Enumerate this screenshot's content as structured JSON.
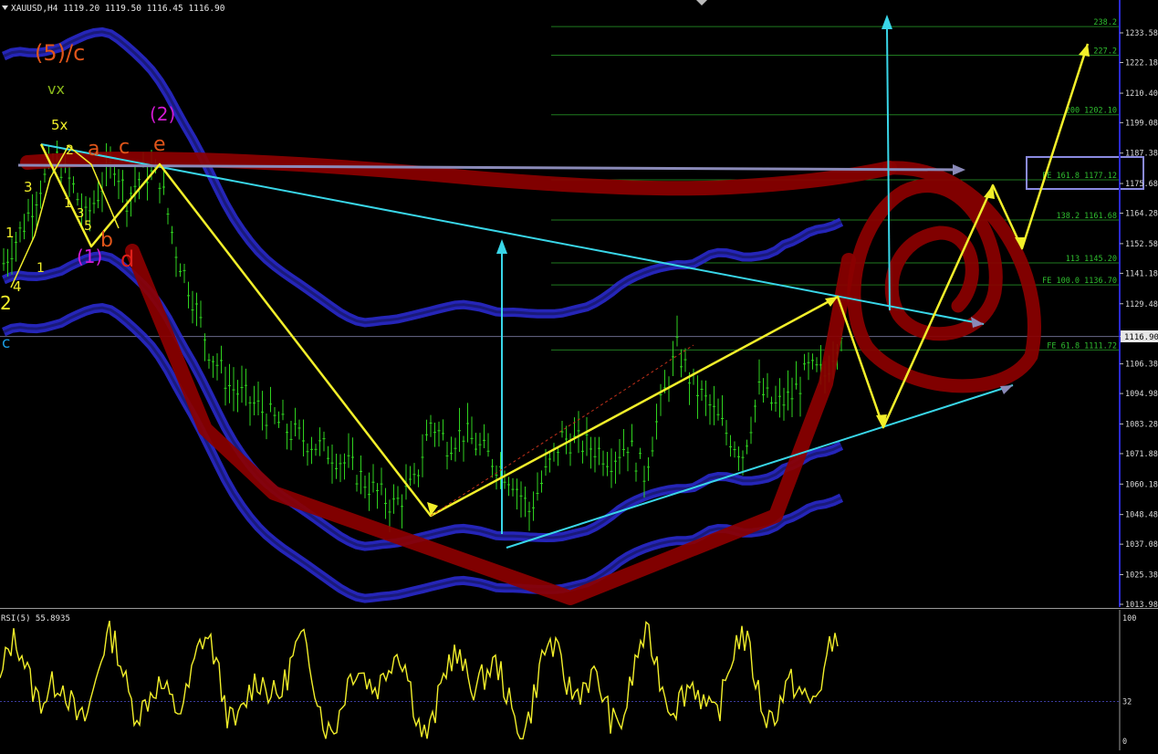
{
  "header": {
    "symbol_line": "XAUUSD,H4  1119.20 1119.50 1116.45 1116.90"
  },
  "colors": {
    "background": "#000000",
    "candles": "#2fd11f",
    "envelope": "#2b2bd8",
    "envelope_core": "#1a1a7a",
    "trend_cyan": "#39d6e8",
    "wave_yellow": "#f2ef2a",
    "hand_red": "#8b0000",
    "fib_line": "#1f7a1f",
    "fib_text": "#2fbf2f",
    "axis": "#2a2ad0",
    "grey_arrow": "#8a8ab8",
    "rsi": "#f2ef2a"
  },
  "chart_data": [
    {
      "type": "candlestick",
      "title": "XAUUSD,H4",
      "ohlc_label": "1119.20 1119.50 1116.45 1116.90",
      "current_price": 1116.9,
      "ylim": [
        1013.98,
        1240.0
      ],
      "y_ticks": [
        1233.58,
        1222.18,
        1210.4,
        1199.08,
        1187.38,
        1175.68,
        1164.28,
        1152.58,
        1141.18,
        1129.48,
        1116.9,
        1106.38,
        1094.98,
        1083.28,
        1071.88,
        1060.18,
        1048.48,
        1037.08,
        1025.38,
        1013.98
      ],
      "y_tick_labels": [
        "1233.58",
        "1222.18",
        "1210.40",
        "1199.08",
        "1187.38",
        "1175.68",
        "1164.28",
        "1152.58",
        "1141.18",
        "1129.48",
        "1116.90",
        "1106.38",
        "1094.98",
        "1083.28",
        "1071.88",
        "1060.18",
        "1048.48",
        "1037.08",
        "1025.38",
        "1013.98"
      ],
      "price_path": [
        [
          0,
          1145
        ],
        [
          5,
          1160
        ],
        [
          9,
          1175
        ],
        [
          13,
          1185
        ],
        [
          17,
          1174
        ],
        [
          20,
          1162
        ],
        [
          24,
          1175
        ],
        [
          27,
          1184
        ],
        [
          30,
          1170
        ],
        [
          34,
          1180
        ],
        [
          38,
          1178
        ],
        [
          42,
          1150
        ],
        [
          46,
          1132
        ],
        [
          50,
          1112
        ],
        [
          55,
          1098
        ],
        [
          60,
          1092
        ],
        [
          65,
          1086
        ],
        [
          70,
          1080
        ],
        [
          75,
          1076
        ],
        [
          80,
          1072
        ],
        [
          85,
          1066
        ],
        [
          90,
          1058
        ],
        [
          95,
          1052
        ],
        [
          100,
          1060
        ],
        [
          104,
          1084
        ],
        [
          108,
          1076
        ],
        [
          112,
          1080
        ],
        [
          116,
          1074
        ],
        [
          120,
          1068
        ],
        [
          124,
          1062
        ],
        [
          128,
          1050
        ],
        [
          132,
          1064
        ],
        [
          136,
          1078
        ],
        [
          140,
          1076
        ],
        [
          144,
          1074
        ],
        [
          148,
          1070
        ],
        [
          152,
          1076
        ],
        [
          156,
          1064
        ],
        [
          160,
          1090
        ],
        [
          164,
          1112
        ],
        [
          168,
          1098
        ],
        [
          172,
          1090
        ],
        [
          176,
          1080
        ],
        [
          180,
          1072
        ],
        [
          184,
          1096
        ],
        [
          188,
          1090
        ],
        [
          192,
          1094
        ],
        [
          196,
          1104
        ],
        [
          200,
          1102
        ],
        [
          204,
          1120
        ]
      ],
      "fib_levels": [
        {
          "label": "238.2",
          "price": 1236.0
        },
        {
          "label": "227.2",
          "price": 1225.0
        },
        {
          "label": "200  1202.10",
          "price": 1202.1
        },
        {
          "label": "FE 161.8  1177.12",
          "price": 1177.12
        },
        {
          "label": "138.2  1161.68",
          "price": 1161.68
        },
        {
          "label": "113  1145.20",
          "price": 1145.2
        },
        {
          "label": "FE 100.0  1136.70",
          "price": 1136.7
        },
        {
          "label": "FE 61.8  1111.72",
          "price": 1111.72
        }
      ],
      "wave_labels": [
        {
          "text": "(5)/c",
          "color": "#e0551a"
        },
        {
          "text": "vx",
          "color": "#8ab81a"
        },
        {
          "text": "5x",
          "color": "#f2ef2a"
        },
        {
          "text": "2",
          "color": "#f2ef2a"
        },
        {
          "text": "a",
          "color": "#e0551a"
        },
        {
          "text": "c",
          "color": "#e0551a"
        },
        {
          "text": "(2)",
          "color": "#d21ad2"
        },
        {
          "text": "e",
          "color": "#e0551a"
        },
        {
          "text": "3",
          "color": "#f2ef2a"
        },
        {
          "text": "1",
          "color": "#f2ef2a"
        },
        {
          "text": "1",
          "color": "#f2ef2a"
        },
        {
          "text": "3",
          "color": "#f2ef2a"
        },
        {
          "text": "5",
          "color": "#f2ef2a"
        },
        {
          "text": "b",
          "color": "#e0551a"
        },
        {
          "text": "(1)",
          "color": "#d21ad2"
        },
        {
          "text": "d",
          "color": "#e0201a"
        },
        {
          "text": "1",
          "color": "#f2ef2a"
        },
        {
          "text": "4",
          "color": "#f2ef2a"
        },
        {
          "text": "2",
          "color": "#f2ef2a"
        },
        {
          "text": "c",
          "color": "#1a9ae0"
        },
        {
          "text": "iv",
          "color": "#5a7a1a"
        }
      ]
    },
    {
      "type": "line",
      "title": "RSI(5) 55.8935",
      "ylim": [
        0,
        100
      ],
      "y_ticks": [
        100,
        32,
        0
      ],
      "y_tick_labels": [
        "100",
        "32",
        "0"
      ],
      "level": 32
    }
  ]
}
